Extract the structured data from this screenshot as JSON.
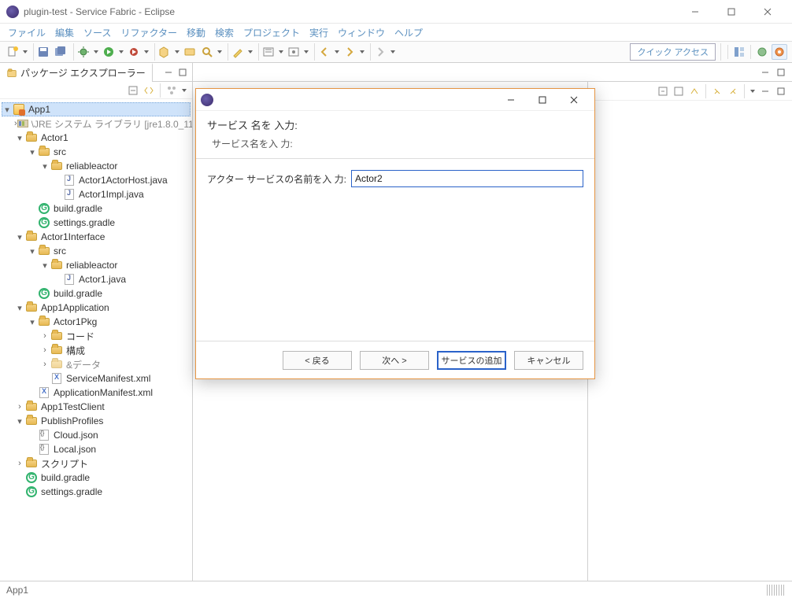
{
  "window": {
    "title": "plugin-test - Service Fabric - Eclipse"
  },
  "menu": [
    "ファイル",
    "編集",
    "ソース",
    "リファクター",
    "移動",
    "検索",
    "プロジェクト",
    "実行",
    "ウィンドウ",
    "ヘルプ"
  ],
  "toolbar": {
    "quick_access": "クイック アクセス"
  },
  "pkg_explorer": {
    "title": "パッケージ エクスプローラー"
  },
  "tree": {
    "project": "App1",
    "jre": "\\JRE システム ライブラリ [jre1.8.0_111]",
    "actor1": "Actor1",
    "src": "src",
    "reliableactor": "reliableactor",
    "actorhost": "Actor1ActorHost.java",
    "actorimpl": "Actor1Impl.java",
    "buildgradle": "build.gradle",
    "settingsgradle": "settings.gradle",
    "actor1iface": "Actor1Interface",
    "actor1java": "Actor1.java",
    "app1application": "App1Application",
    "actor1pkg": "Actor1Pkg",
    "code": "コード",
    "config": "構成",
    "data": "&データ",
    "servicemanifest": "ServiceManifest.xml",
    "appmanifest": "ApplicationManifest.xml",
    "testclient": "App1TestClient",
    "publishprofiles": "PublishProfiles",
    "cloudjson": "Cloud.json",
    "localjson": "Local.json",
    "script": "スクリプト"
  },
  "statusbar": {
    "text": "App1"
  },
  "dialog": {
    "header": "サービス 名を 入力:",
    "sub": "サービス名を入 力:",
    "field_label": "アクター サービスの名前を入 力:",
    "field_value": "Actor2",
    "btn_back": "< 戻る",
    "btn_next": "次へ >",
    "btn_finish": "サービスの追加",
    "btn_cancel": "キャンセル"
  }
}
